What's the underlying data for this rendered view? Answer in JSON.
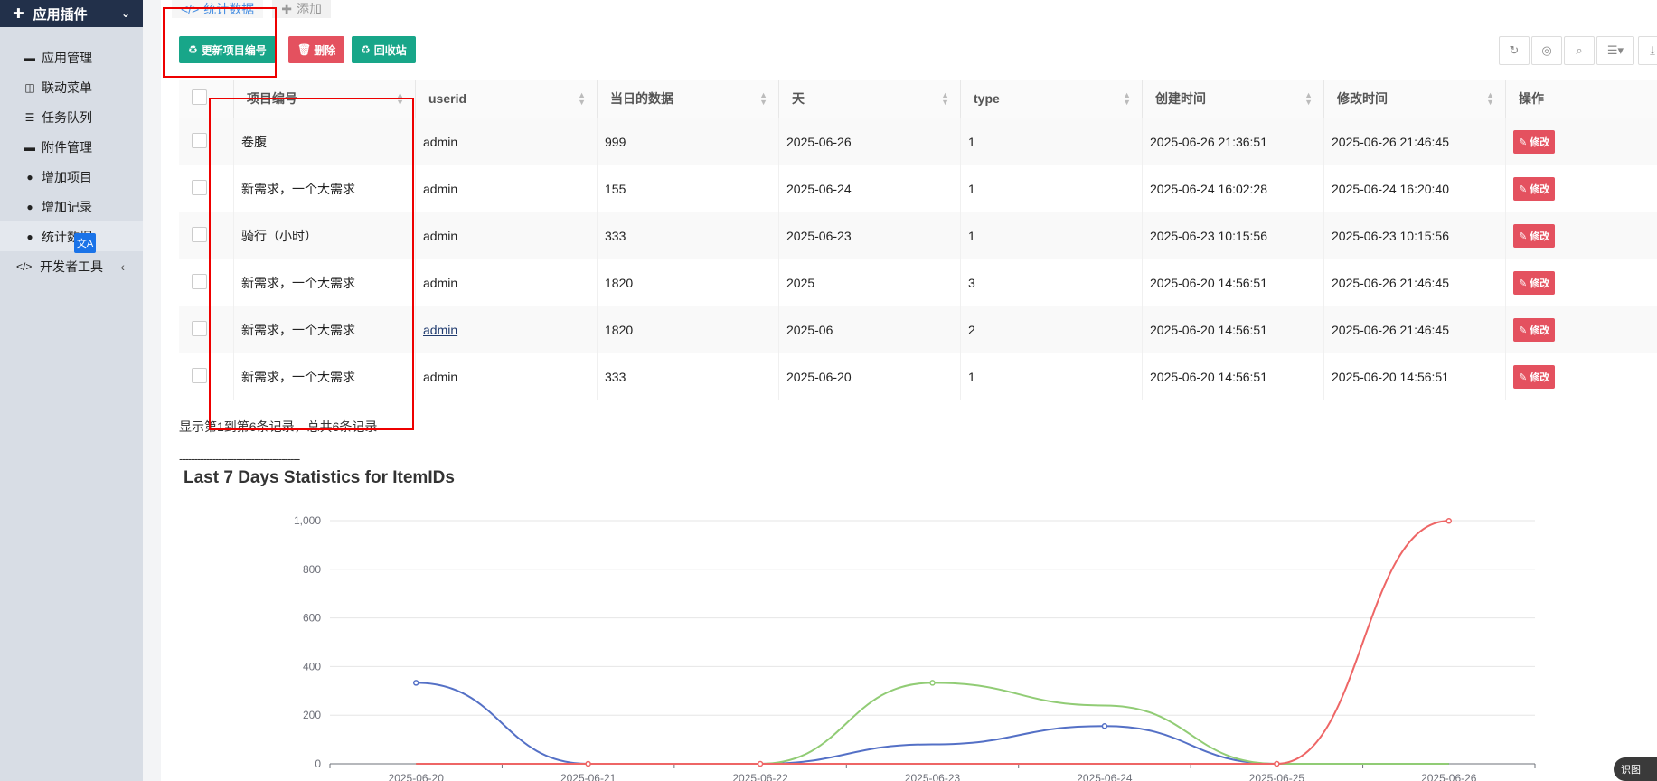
{
  "sidebar": {
    "header": "应用插件",
    "items": [
      {
        "label": "应用管理",
        "icon": "folder-icon"
      },
      {
        "label": "联动菜单",
        "icon": "columns-icon"
      },
      {
        "label": "任务队列",
        "icon": "list-icon"
      },
      {
        "label": "附件管理",
        "icon": "folder-icon"
      },
      {
        "label": "增加项目",
        "icon": "bulb-icon"
      },
      {
        "label": "增加记录",
        "icon": "bulb-icon"
      },
      {
        "label": "统计数据",
        "icon": "bulb-icon"
      }
    ],
    "dev_tools": "开发者工具"
  },
  "tabs": [
    {
      "label": "统计数据",
      "icon": "code-icon"
    },
    {
      "label": "添加",
      "icon": "plus-icon"
    }
  ],
  "toolbar": {
    "update_label": "更新项目编号",
    "delete_label": "删除",
    "recycle_label": "回收站"
  },
  "table": {
    "columns": [
      "项目编号",
      "userid",
      "当日的数据",
      "天",
      "type",
      "创建时间",
      "修改时间",
      "操作"
    ],
    "edit_label": "修改",
    "rows": [
      [
        "卷腹",
        "admin",
        "999",
        "2025-06-26",
        "1",
        "2025-06-26 21:36:51",
        "2025-06-26 21:46:45"
      ],
      [
        "新需求，一个大需求",
        "admin",
        "155",
        "2025-06-24",
        "1",
        "2025-06-24 16:02:28",
        "2025-06-24 16:20:40"
      ],
      [
        "骑行（小时）",
        "admin",
        "333",
        "2025-06-23",
        "1",
        "2025-06-23 10:15:56",
        "2025-06-23 10:15:56"
      ],
      [
        "新需求，一个大需求",
        "admin",
        "1820",
        "2025",
        "3",
        "2025-06-20 14:56:51",
        "2025-06-26 21:46:45"
      ],
      [
        "新需求，一个大需求",
        "admin",
        "1820",
        "2025-06",
        "2",
        "2025-06-20 14:56:51",
        "2025-06-26 21:46:45"
      ],
      [
        "新需求，一个大需求",
        "admin",
        "333",
        "2025-06-20",
        "1",
        "2025-06-20 14:56:51",
        "2025-06-20 14:56:51"
      ]
    ]
  },
  "records_text": "显示第1到第6条记录，总共6条记录",
  "separator": "----------------------------------------",
  "translate_badge": "文A",
  "corner_label": "识图",
  "chart_data": {
    "type": "line",
    "title": "Last 7 Days Statistics  for ItemIDs",
    "categories": [
      "2025-06-20",
      "2025-06-21",
      "2025-06-22",
      "2025-06-23",
      "2025-06-24",
      "2025-06-25",
      "2025-06-26"
    ],
    "ylim": [
      0,
      1000
    ],
    "yticks": [
      0,
      200,
      400,
      600,
      800,
      1000
    ],
    "ytick_labels": [
      "0",
      "200",
      "400",
      "600",
      "800",
      "1,000"
    ],
    "grid": true,
    "series": [
      {
        "values": [
          333,
          0,
          0,
          80,
          155,
          0,
          0
        ],
        "color": "#5470c6",
        "marked": [
          0,
          4
        ]
      },
      {
        "values": [
          0,
          0,
          0,
          333,
          240,
          0,
          0
        ],
        "color": "#91cc75",
        "marked": [
          3
        ]
      },
      {
        "values": [
          0,
          0,
          0,
          0,
          0,
          0,
          999
        ],
        "color": "#ee6666",
        "marked": [
          1,
          2,
          5,
          6
        ]
      }
    ]
  }
}
